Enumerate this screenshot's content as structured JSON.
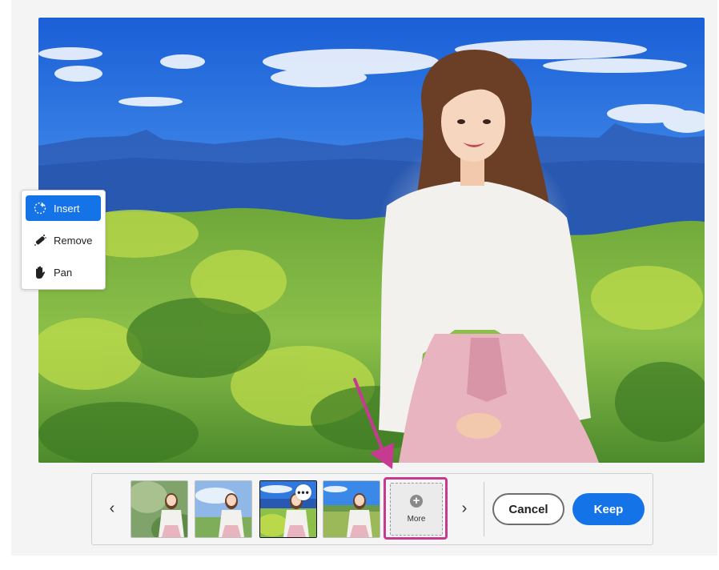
{
  "tools": {
    "items": [
      {
        "label": "Insert",
        "icon": "insert-icon",
        "active": true
      },
      {
        "label": "Remove",
        "icon": "remove-icon",
        "active": false
      },
      {
        "label": "Pan",
        "icon": "hand-icon",
        "active": false
      }
    ]
  },
  "strip": {
    "prev_icon": "chevron-left-icon",
    "next_icon": "chevron-right-icon",
    "prev_glyph": "‹",
    "next_glyph": "›",
    "thumbnails": [
      {
        "background": "trees-with-person"
      },
      {
        "background": "sky-with-person"
      },
      {
        "background": "mountain-meadow-with-person",
        "selected": true
      },
      {
        "background": "field-with-person"
      }
    ],
    "options_glyph": "•••",
    "more_label": "More",
    "more_glyph": "+",
    "cancel_label": "Cancel",
    "keep_label": "Keep"
  },
  "colors": {
    "accent": "#1473e6",
    "highlight": "#c73a92"
  }
}
